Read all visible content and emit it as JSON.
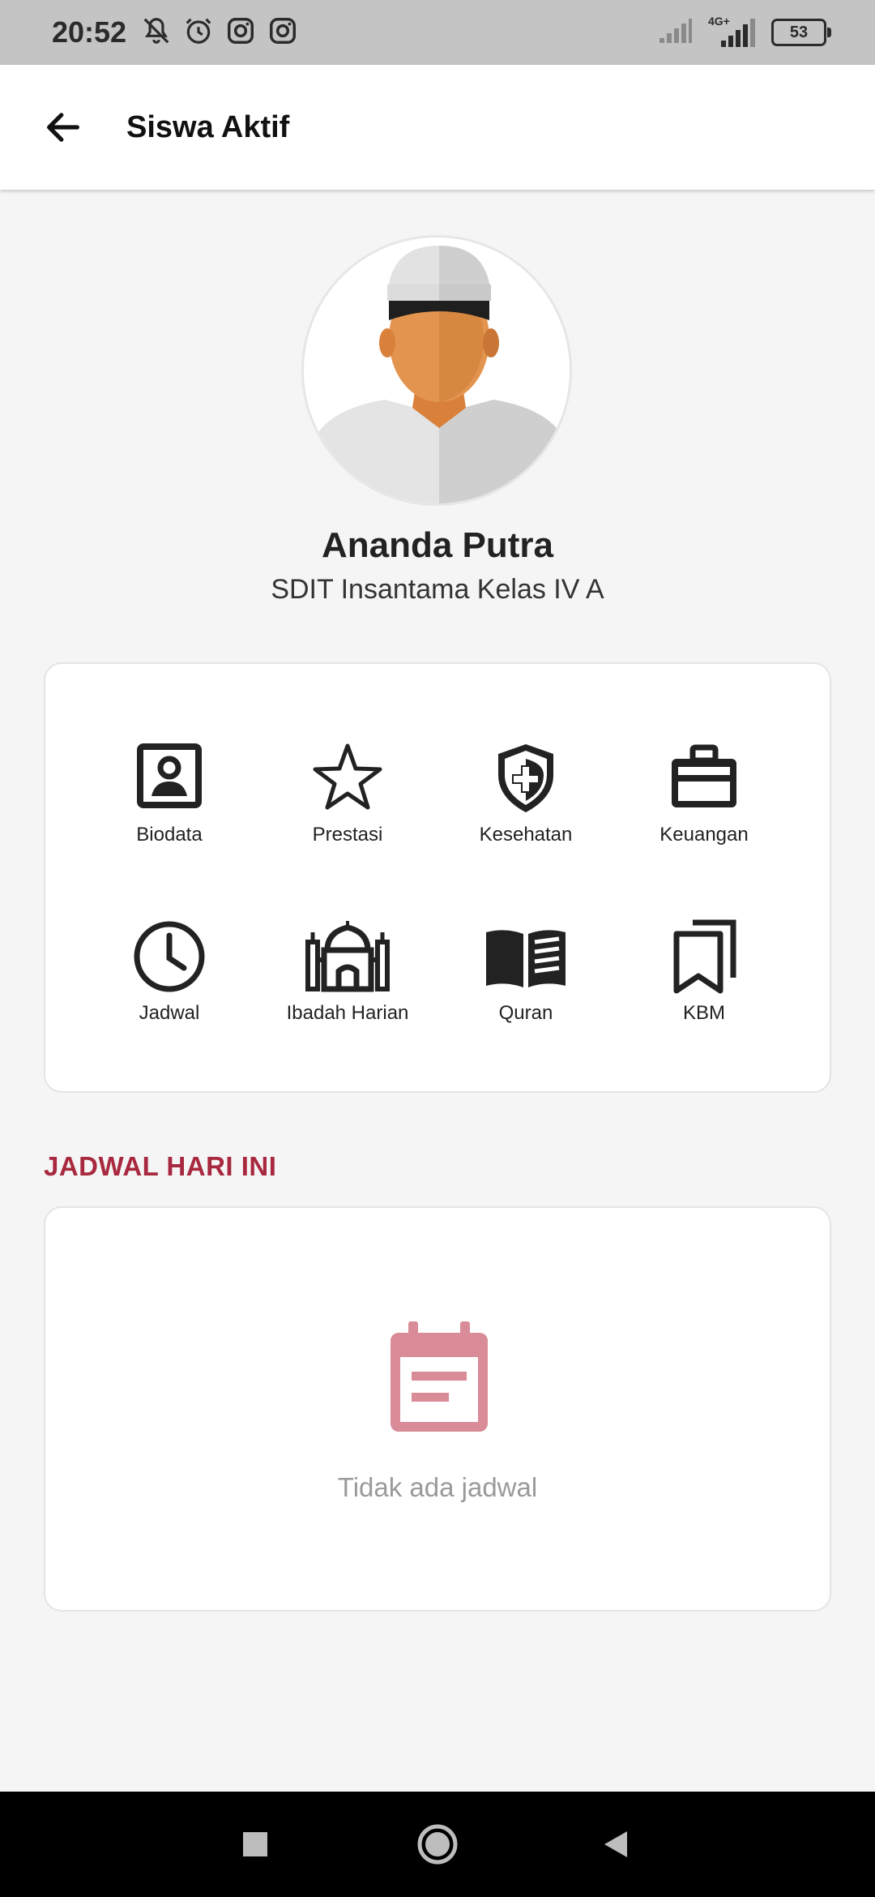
{
  "status_bar": {
    "time": "20:52",
    "battery": "53",
    "network": "4G+"
  },
  "app_bar": {
    "title": "Siswa Aktif",
    "back_icon": "arrow-left-icon"
  },
  "profile": {
    "name": "Ananda Putra",
    "class": "SDIT Insantama Kelas IV A"
  },
  "menu": {
    "items": [
      {
        "label": "Biodata",
        "icon": "portrait-icon"
      },
      {
        "label": "Prestasi",
        "icon": "star-icon"
      },
      {
        "label": "Kesehatan",
        "icon": "shield-plus-icon"
      },
      {
        "label": "Keuangan",
        "icon": "briefcase-icon"
      },
      {
        "label": "Jadwal",
        "icon": "clock-icon"
      },
      {
        "label": "Ibadah Harian",
        "icon": "mosque-icon"
      },
      {
        "label": "Quran",
        "icon": "open-book-icon"
      },
      {
        "label": "KBM",
        "icon": "bookmarks-icon"
      }
    ]
  },
  "schedule": {
    "title": "JADWAL HARI INI",
    "empty_text": "Tidak ada jadwal"
  },
  "colors": {
    "accent": "#a8283f",
    "empty_icon": "#d98b98",
    "status_bar": "#c4c4c4"
  }
}
